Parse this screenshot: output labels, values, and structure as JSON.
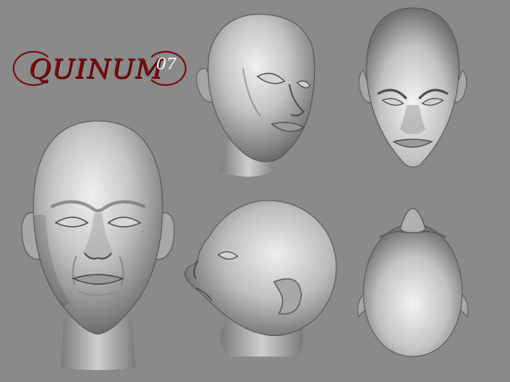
{
  "logo": {
    "text": "QUINUM",
    "year": "07",
    "color": "#7a0b0f"
  },
  "colors": {
    "background": "#8a8a8a",
    "skin_light": "#e9e9e9",
    "skin_mid": "#b4b4b4",
    "skin_dark": "#5a5a5a"
  },
  "views": [
    {
      "name": "front"
    },
    {
      "name": "three-quarter-up"
    },
    {
      "name": "three-quarter-down"
    },
    {
      "name": "profile-up"
    },
    {
      "name": "top"
    }
  ]
}
